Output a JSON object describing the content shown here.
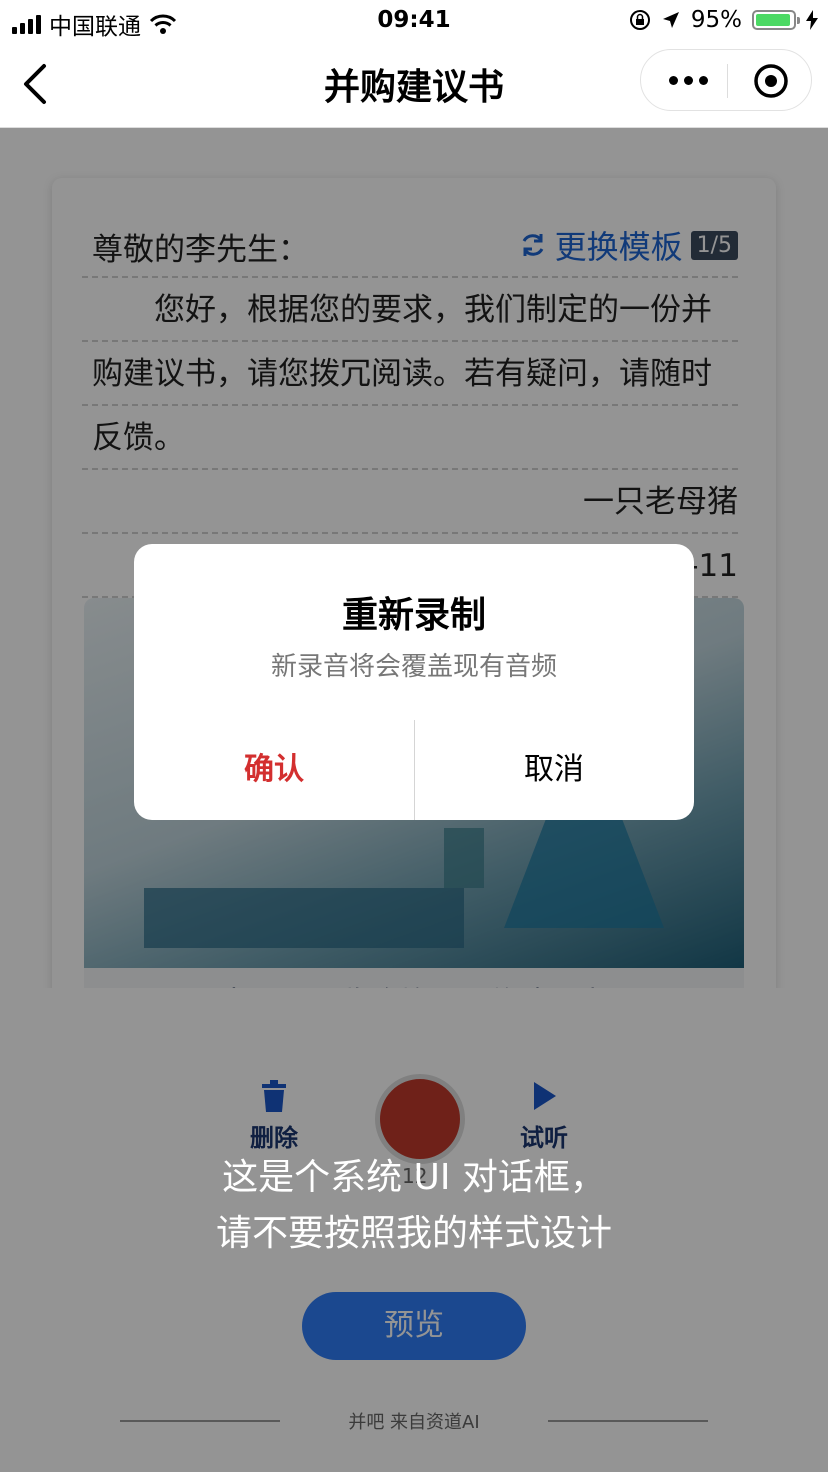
{
  "status_bar": {
    "carrier": "中国联通",
    "time": "09:41",
    "battery": "95%"
  },
  "nav": {
    "title": "并购建议书"
  },
  "letter": {
    "greeting": "尊敬的李先生：",
    "change_template": "更换模板",
    "template_page": "1/5",
    "body_lines": [
      "　　您好，根据您的要求，我们制定的一份并",
      "购建议书，请您拨冗阅读。若有疑问，请随时",
      "反馈。"
    ],
    "signature": "一只老母猪",
    "date_fragment": "-11",
    "caption": "中兴通讯收购烽火通信建议书"
  },
  "recorder": {
    "delete_label": "删除",
    "listen_label": "试听",
    "timer_fragment": "12"
  },
  "preview_button": "预览",
  "footer": "并吧 来自资道AI",
  "overlay_note": [
    "这是个系统 UI 对话框，",
    "请不要按照我的样式设计"
  ],
  "dialog": {
    "title": "重新录制",
    "message": "新录音将会覆盖现有音频",
    "confirm": "确认",
    "cancel": "取消"
  },
  "colors": {
    "accent_blue": "#1e64d0",
    "confirm_red": "#d32f2f",
    "record_red": "#c0392b"
  }
}
